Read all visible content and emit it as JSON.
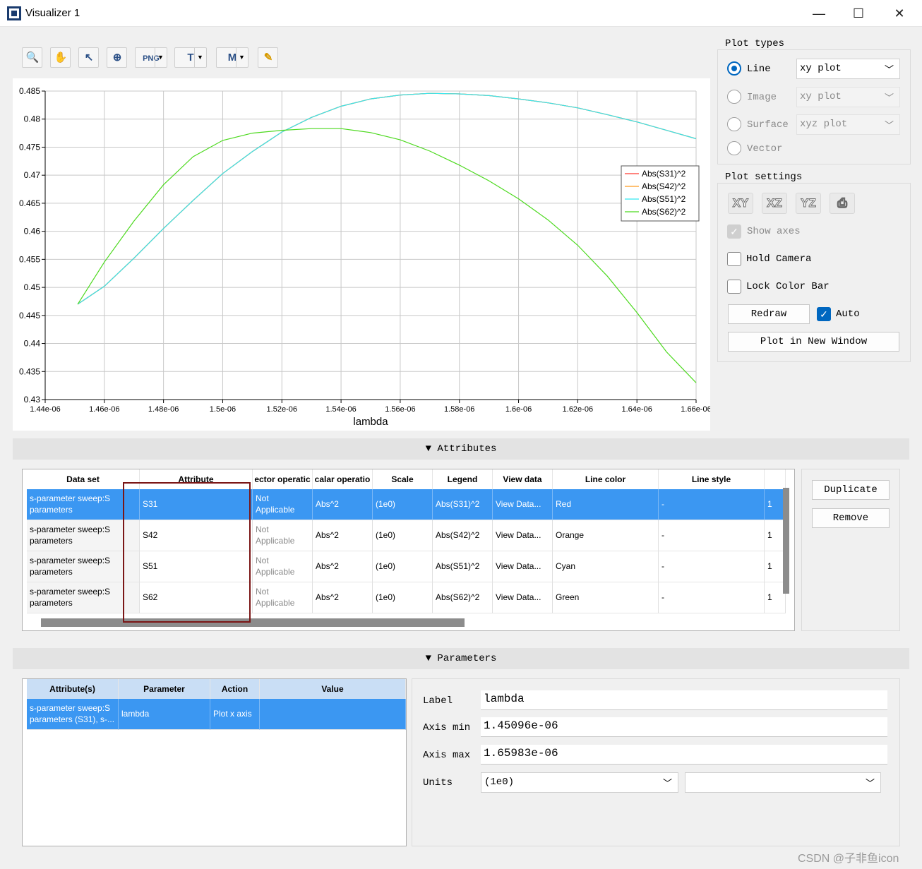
{
  "window": {
    "title": "Visualizer 1",
    "minimize": "—",
    "maximize": "☐",
    "close": "✕"
  },
  "toolbar": [
    {
      "name": "zoom-tool-button",
      "glyph": "🔍",
      "dropdown": false
    },
    {
      "name": "pan-tool-button",
      "glyph": "✋",
      "dropdown": false
    },
    {
      "name": "select-tool-button",
      "glyph": "↖",
      "dropdown": false
    },
    {
      "name": "zoom-extents-button",
      "glyph": "⊕",
      "dropdown": false
    },
    {
      "name": "export-png-button",
      "glyph": "PNG",
      "dropdown": true
    },
    {
      "name": "text-annotation-button",
      "glyph": "T",
      "dropdown": true
    },
    {
      "name": "marker-button",
      "glyph": "M",
      "dropdown": true
    },
    {
      "name": "edit-button",
      "glyph": "✎",
      "dropdown": false
    }
  ],
  "chart_data": {
    "type": "line",
    "xlabel": "lambda",
    "ylabel": "",
    "xlim": [
      1.44e-06,
      1.66e-06
    ],
    "ylim": [
      0.43,
      0.485
    ],
    "x_ticks": [
      "1.44e-06",
      "1.46e-06",
      "1.48e-06",
      "1.5e-06",
      "1.52e-06",
      "1.54e-06",
      "1.56e-06",
      "1.58e-06",
      "1.6e-06",
      "1.62e-06",
      "1.64e-06",
      "1.66e-06"
    ],
    "x_tick_values": [
      1.44e-06,
      1.46e-06,
      1.48e-06,
      1.5e-06,
      1.52e-06,
      1.54e-06,
      1.56e-06,
      1.58e-06,
      1.6e-06,
      1.62e-06,
      1.64e-06,
      1.66e-06
    ],
    "y_ticks": [
      "0.485",
      "0.48",
      "0.475",
      "0.47",
      "0.465",
      "0.46",
      "0.455",
      "0.45",
      "0.445",
      "0.44",
      "0.435",
      "0.43"
    ],
    "y_tick_values": [
      0.485,
      0.48,
      0.475,
      0.47,
      0.465,
      0.46,
      0.455,
      0.45,
      0.445,
      0.44,
      0.435,
      0.43
    ],
    "grid": true,
    "legend_position": "right",
    "series": [
      {
        "name": "Abs(S31)^2",
        "color": "#ff3b30",
        "x": [
          1.451e-06,
          1.46e-06,
          1.47e-06,
          1.48e-06,
          1.49e-06,
          1.5e-06,
          1.51e-06,
          1.52e-06,
          1.53e-06,
          1.54e-06,
          1.55e-06,
          1.56e-06,
          1.57e-06,
          1.58e-06,
          1.59e-06,
          1.6e-06,
          1.61e-06,
          1.62e-06,
          1.63e-06,
          1.64e-06,
          1.65e-06,
          1.66e-06
        ],
        "y": [
          0.447,
          0.4502,
          0.4552,
          0.4605,
          0.4655,
          0.4703,
          0.4742,
          0.4777,
          0.4803,
          0.4823,
          0.4836,
          0.4843,
          0.4846,
          0.4845,
          0.4842,
          0.4836,
          0.4829,
          0.482,
          0.4808,
          0.4795,
          0.478,
          0.4765
        ]
      },
      {
        "name": "Abs(S42)^2",
        "color": "#ff9a1f",
        "x": [
          1.451e-06,
          1.46e-06,
          1.47e-06,
          1.48e-06,
          1.49e-06,
          1.5e-06,
          1.51e-06,
          1.52e-06,
          1.53e-06,
          1.54e-06,
          1.55e-06,
          1.56e-06,
          1.57e-06,
          1.58e-06,
          1.59e-06,
          1.6e-06,
          1.61e-06,
          1.62e-06,
          1.63e-06,
          1.64e-06,
          1.65e-06,
          1.66e-06
        ],
        "y": [
          0.447,
          0.4502,
          0.4552,
          0.4605,
          0.4655,
          0.4703,
          0.4742,
          0.4777,
          0.4803,
          0.4823,
          0.4836,
          0.4843,
          0.4846,
          0.4845,
          0.4842,
          0.4836,
          0.4829,
          0.482,
          0.4808,
          0.4795,
          0.478,
          0.4765
        ]
      },
      {
        "name": "Abs(S51)^2",
        "color": "#35e6f0",
        "x": [
          1.451e-06,
          1.46e-06,
          1.47e-06,
          1.48e-06,
          1.49e-06,
          1.5e-06,
          1.51e-06,
          1.52e-06,
          1.53e-06,
          1.54e-06,
          1.55e-06,
          1.56e-06,
          1.57e-06,
          1.58e-06,
          1.59e-06,
          1.6e-06,
          1.61e-06,
          1.62e-06,
          1.63e-06,
          1.64e-06,
          1.65e-06,
          1.66e-06
        ],
        "y": [
          0.447,
          0.4502,
          0.4552,
          0.4605,
          0.4655,
          0.4703,
          0.4742,
          0.4777,
          0.4803,
          0.4823,
          0.4836,
          0.4843,
          0.4846,
          0.4845,
          0.4842,
          0.4836,
          0.4829,
          0.482,
          0.4808,
          0.4795,
          0.478,
          0.4765
        ]
      },
      {
        "name": "Abs(S62)^2",
        "color": "#4cd91e",
        "x": [
          1.451e-06,
          1.46e-06,
          1.47e-06,
          1.48e-06,
          1.49e-06,
          1.5e-06,
          1.51e-06,
          1.52e-06,
          1.53e-06,
          1.54e-06,
          1.55e-06,
          1.56e-06,
          1.57e-06,
          1.58e-06,
          1.59e-06,
          1.6e-06,
          1.61e-06,
          1.62e-06,
          1.63e-06,
          1.64e-06,
          1.65e-06,
          1.66e-06
        ],
        "y": [
          0.447,
          0.4545,
          0.4618,
          0.4683,
          0.4733,
          0.4762,
          0.4775,
          0.478,
          0.4783,
          0.4783,
          0.4776,
          0.4763,
          0.4743,
          0.4718,
          0.469,
          0.4658,
          0.462,
          0.4575,
          0.452,
          0.4455,
          0.4385,
          0.433
        ]
      }
    ]
  },
  "plot_types": {
    "title": "Plot types",
    "options": [
      {
        "label": "Line",
        "combo": "xy plot",
        "checked": true,
        "enabled": true
      },
      {
        "label": "Image",
        "combo": "xy plot",
        "checked": false,
        "enabled": false
      },
      {
        "label": "Surface",
        "combo": "xyz plot",
        "checked": false,
        "enabled": false
      },
      {
        "label": "Vector",
        "combo": "",
        "checked": false,
        "enabled": false
      }
    ]
  },
  "plot_settings": {
    "title": "Plot settings",
    "view_buttons": [
      "XY",
      "XZ",
      "YZ",
      "⎙"
    ],
    "show_axes": "Show axes",
    "hold_camera": "Hold Camera",
    "lock_color_bar": "Lock Color Bar",
    "redraw": "Redraw",
    "auto": "Auto",
    "plot_new_window": "Plot in New Window"
  },
  "attributes": {
    "header": "Attributes",
    "columns": [
      "Data set",
      "Attribute",
      "ector operatic",
      "calar operatio",
      "Scale",
      "Legend",
      "View data",
      "Line color",
      "Line style",
      ""
    ],
    "rows": [
      {
        "data_set": "s-parameter sweep:S parameters",
        "attribute": "S31",
        "vector_op": "Not Applicable",
        "scalar_op": "Abs^2",
        "scale": "(1e0)",
        "legend": "Abs(S31)^2",
        "view": "View Data...",
        "color": "Red",
        "style": "-",
        "width": "1"
      },
      {
        "data_set": "s-parameter sweep:S parameters",
        "attribute": "S42",
        "vector_op": "Not Applicable",
        "scalar_op": "Abs^2",
        "scale": "(1e0)",
        "legend": "Abs(S42)^2",
        "view": "View Data...",
        "color": "Orange",
        "style": "-",
        "width": "1"
      },
      {
        "data_set": "s-parameter sweep:S parameters",
        "attribute": "S51",
        "vector_op": "Not Applicable",
        "scalar_op": "Abs^2",
        "scale": "(1e0)",
        "legend": "Abs(S51)^2",
        "view": "View Data...",
        "color": "Cyan",
        "style": "-",
        "width": "1"
      },
      {
        "data_set": "s-parameter sweep:S parameters",
        "attribute": "S62",
        "vector_op": "Not Applicable",
        "scalar_op": "Abs^2",
        "scale": "(1e0)",
        "legend": "Abs(S62)^2",
        "view": "View Data...",
        "color": "Green",
        "style": "-",
        "width": "1"
      }
    ],
    "duplicate": "Duplicate",
    "remove": "Remove"
  },
  "parameters": {
    "header": "Parameters",
    "columns": [
      "Attribute(s)",
      "Parameter",
      "Action",
      "Value"
    ],
    "rows": [
      {
        "attrs": "s-parameter sweep:S parameters (S31), s-...",
        "param": "lambda",
        "action": "Plot x axis",
        "value": ""
      }
    ],
    "label_label": "Label",
    "label_value": "lambda",
    "axis_min_label": "Axis min",
    "axis_min_value": "1.45096e-06",
    "axis_max_label": "Axis max",
    "axis_max_value": "1.65983e-06",
    "units_label": "Units",
    "units_value": "(1e0)",
    "units_second": ""
  },
  "watermark": "CSDN @子非鱼icon"
}
